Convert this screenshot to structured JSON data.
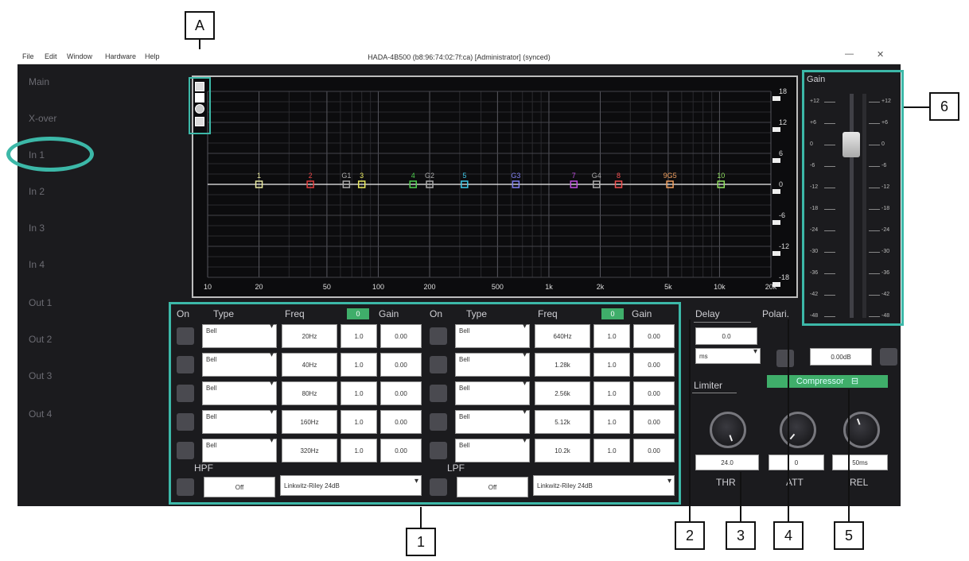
{
  "menu": [
    "File",
    "Edit",
    "Window",
    "Hardware",
    "Help"
  ],
  "window_title": "HADA-4B500 (b8:96:74:02:7f:ca) [Administrator] (synced)",
  "window_controls": {
    "minimize": "—",
    "close": "✕"
  },
  "sidebar": [
    "Main",
    "X-over",
    "In 1",
    "In 2",
    "In 3",
    "In 4",
    "Out 1",
    "Out 2",
    "Out 3",
    "Out 4"
  ],
  "graph": {
    "x_ticks": [
      "10",
      "20",
      "50",
      "100",
      "200",
      "500",
      "1k",
      "2k",
      "5k",
      "10k",
      "20k"
    ],
    "y_ticks": [
      "18",
      "12",
      "6",
      "0",
      "-6",
      "-12",
      "-18"
    ],
    "points": [
      {
        "label": "1",
        "color": "#e8e8a0",
        "freq": 20
      },
      {
        "label": "2",
        "color": "#e04040",
        "freq": 40
      },
      {
        "label": "G1",
        "color": "#aaaaaa",
        "freq": 65
      },
      {
        "label": "3",
        "color": "#e8e860",
        "freq": 80
      },
      {
        "label": "4",
        "color": "#50d050",
        "freq": 160
      },
      {
        "label": "G2",
        "color": "#aaaaaa",
        "freq": 200
      },
      {
        "label": "5",
        "color": "#40c8e8",
        "freq": 320
      },
      {
        "label": "G3",
        "color": "#8080f0",
        "freq": 640
      },
      {
        "label": "7",
        "color": "#c050e0",
        "freq": 1400
      },
      {
        "label": "G4",
        "color": "#aaaaaa",
        "freq": 1900
      },
      {
        "label": "8",
        "color": "#f05050",
        "freq": 2560
      },
      {
        "label": "9G5",
        "color": "#f0a060",
        "freq": 5120
      },
      {
        "label": "10",
        "color": "#90e060",
        "freq": 10200
      }
    ]
  },
  "eq_headers": {
    "on": "On",
    "type": "Type",
    "freq": "Freq",
    "gain": "Gain",
    "toggle": "0"
  },
  "bands_left": [
    {
      "type": "Bell",
      "freq": "20Hz",
      "q": "1.0",
      "gain": "0.00"
    },
    {
      "type": "Bell",
      "freq": "40Hz",
      "q": "1.0",
      "gain": "0.00"
    },
    {
      "type": "Bell",
      "freq": "80Hz",
      "q": "1.0",
      "gain": "0.00"
    },
    {
      "type": "Bell",
      "freq": "160Hz",
      "q": "1.0",
      "gain": "0.00"
    },
    {
      "type": "Bell",
      "freq": "320Hz",
      "q": "1.0",
      "gain": "0.00"
    }
  ],
  "bands_right": [
    {
      "type": "Bell",
      "freq": "640Hz",
      "q": "1.0",
      "gain": "0.00"
    },
    {
      "type": "Bell",
      "freq": "1.28k",
      "q": "1.0",
      "gain": "0.00"
    },
    {
      "type": "Bell",
      "freq": "2.56k",
      "q": "1.0",
      "gain": "0.00"
    },
    {
      "type": "Bell",
      "freq": "5.12k",
      "q": "1.0",
      "gain": "0.00"
    },
    {
      "type": "Bell",
      "freq": "10.2k",
      "q": "1.0",
      "gain": "0.00"
    }
  ],
  "hpf": {
    "label": "HPF",
    "value": "Off",
    "filter": "Linkwitz-Riley 24dB"
  },
  "lpf": {
    "label": "LPF",
    "value": "Off",
    "filter": "Linkwitz-Riley 24dB"
  },
  "delay": {
    "label": "Delay",
    "value": "0.0",
    "unit": "ms"
  },
  "polarity": {
    "label": "Polari.",
    "gain": "0.00dB"
  },
  "limiter": {
    "label": "Limiter"
  },
  "compressor": {
    "label": "Compressor",
    "icon": "⊟"
  },
  "knobs": [
    {
      "name": "THR",
      "value": "24.0"
    },
    {
      "name": "ATT",
      "value": "0"
    },
    {
      "name": "REL",
      "value": "50ms"
    }
  ],
  "gain_panel": {
    "title": "Gain",
    "scale": [
      "+12",
      "+6",
      "0",
      "-6",
      "-12",
      "-18",
      "-24",
      "-30",
      "-36",
      "-42",
      "-48"
    ],
    "level_db": 0
  },
  "callouts": {
    "a": "A",
    "n1": "1",
    "n2": "2",
    "n3": "3",
    "n4": "4",
    "n5": "5",
    "n6": "6"
  },
  "accent": "#3cb8a8"
}
